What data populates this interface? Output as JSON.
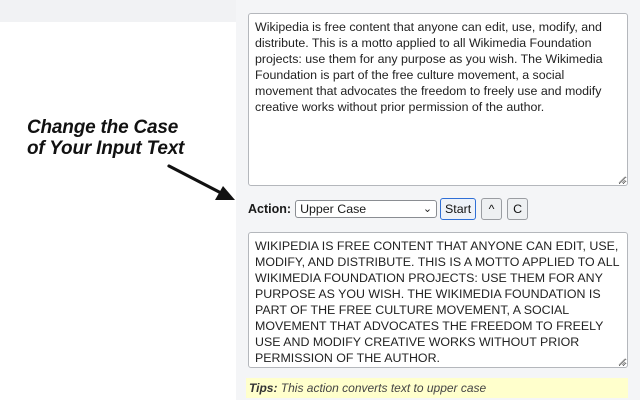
{
  "caption": {
    "line1": "Change the Case",
    "line2": "of Your Input Text"
  },
  "input": {
    "text": "Wikipedia is free content that anyone can edit, use, modify, and distribute. This is a motto applied to all Wikimedia Foundation projects: use them for any purpose as you wish. The Wikimedia Foundation is part of the free culture movement, a social movement that advocates the freedom to freely use and modify creative works without prior permission of the author."
  },
  "action": {
    "label": "Action:",
    "selected": "Upper Case",
    "start_label": "Start",
    "caret_label": "^",
    "clear_label": "C"
  },
  "output": {
    "text": "WIKIPEDIA IS FREE CONTENT THAT ANYONE CAN EDIT, USE, MODIFY, AND DISTRIBUTE. THIS IS A MOTTO APPLIED TO ALL WIKIMEDIA FOUNDATION PROJECTS: USE THEM FOR ANY PURPOSE AS YOU WISH. THE WIKIMEDIA FOUNDATION IS PART OF THE FREE CULTURE MOVEMENT, A SOCIAL MOVEMENT THAT ADVOCATES THE FREEDOM TO FREELY USE AND MODIFY CREATIVE WORKS WITHOUT PRIOR PERMISSION OF THE AUTHOR."
  },
  "tips": {
    "label": "Tips:",
    "text": " This action converts text to upper case"
  },
  "icons": {
    "arrow": "arrow-pointing-right-down",
    "select_chevron": "chevron-down-icon",
    "resize_grip": "resize-grip-icon"
  },
  "colors": {
    "panel_bg": "#f4f5f7",
    "start_border": "#2f6fd6",
    "tips_bg": "#ffffcc"
  }
}
